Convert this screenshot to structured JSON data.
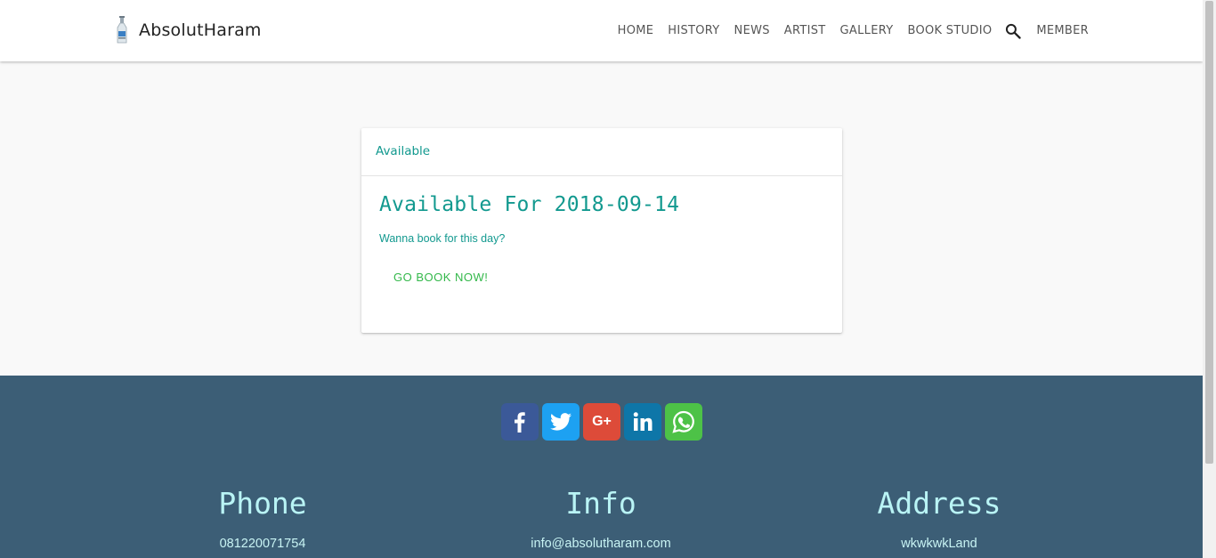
{
  "brand": {
    "name": "AbsolutHaram",
    "logo_icon": "bottle-logo-icon"
  },
  "nav": {
    "items": [
      {
        "label": "HOME"
      },
      {
        "label": "HISTORY"
      },
      {
        "label": "NEWS"
      },
      {
        "label": "ARTIST"
      },
      {
        "label": "GALLERY"
      },
      {
        "label": "BOOK STUDIO"
      }
    ],
    "search_icon": "search-icon",
    "member": "MEMBER"
  },
  "card": {
    "tab_label": "Available",
    "title": "Available For 2018-09-14",
    "subtitle": "Wanna book for this day?",
    "button_label": "GO BOOK NOW!"
  },
  "footer": {
    "social": [
      {
        "name": "facebook",
        "icon": "facebook-icon",
        "color": "#3b5998"
      },
      {
        "name": "twitter",
        "icon": "twitter-icon",
        "color": "#1da1f2"
      },
      {
        "name": "google-plus",
        "icon": "google-plus-icon",
        "color": "#dd4b39",
        "text": "G+"
      },
      {
        "name": "linkedin",
        "icon": "linkedin-icon",
        "color": "#0e76a8"
      },
      {
        "name": "whatsapp",
        "icon": "whatsapp-icon",
        "color": "#4dc247"
      }
    ],
    "columns": [
      {
        "heading": "Phone",
        "value": "081220071754"
      },
      {
        "heading": "Info",
        "value": "info@absolutharam.com"
      },
      {
        "heading": "Address",
        "value": "wkwkwkLand"
      }
    ]
  },
  "colors": {
    "accent": "#12998f",
    "button_text": "#33b84a",
    "footer_bg": "#3c5e76",
    "footer_heading": "#b9f4f5"
  }
}
